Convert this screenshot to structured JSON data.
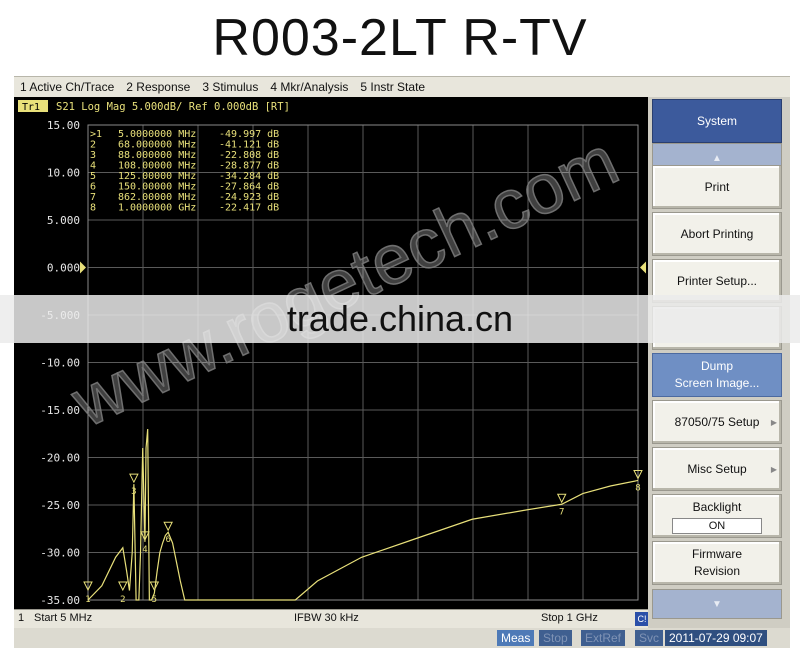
{
  "page_title": "R003-2LT  R-TV",
  "menu": [
    "1 Active Ch/Trace",
    "2 Response",
    "3 Stimulus",
    "4 Mkr/Analysis",
    "5 Instr State"
  ],
  "trace": {
    "label": "Tr1",
    "header": "S21 Log Mag 5.000dB/ Ref 0.000dB [RT]",
    "y_ticks": [
      "15.00",
      "10.00",
      "5.000",
      "0.000",
      "-5.000",
      "-10.00",
      "-15.00",
      "-20.00",
      "-25.00",
      "-30.00",
      "-35.00"
    ],
    "markers": [
      {
        "id": ">1",
        "freq": "5.0000000 MHz",
        "value": "-49.997 dB"
      },
      {
        "id": "2",
        "freq": "68.000000 MHz",
        "value": "-41.121 dB"
      },
      {
        "id": "3",
        "freq": "88.000000 MHz",
        "value": "-22.808 dB"
      },
      {
        "id": "4",
        "freq": "108.00000 MHz",
        "value": "-28.877 dB"
      },
      {
        "id": "5",
        "freq": "125.00000 MHz",
        "value": "-34.284 dB"
      },
      {
        "id": "6",
        "freq": "150.00000 MHz",
        "value": "-27.864 dB"
      },
      {
        "id": "7",
        "freq": "862.00000 MHz",
        "value": "-24.923 dB"
      },
      {
        "id": "8",
        "freq": "1.0000000 GHz",
        "value": "-22.417 dB"
      }
    ]
  },
  "status": {
    "channel": "1",
    "start": "Start 5 MHz",
    "ifbw": "IFBW 30 kHz",
    "stop": "Stop 1 GHz",
    "c1": "C!"
  },
  "bottom": {
    "meas": "Meas",
    "stop": "Stop",
    "extref": "ExtRef",
    "svc": "Svc",
    "datetime": "2011-07-29 09:07"
  },
  "softkeys": {
    "header": "System",
    "print": "Print",
    "abort": "Abort Printing",
    "printer_setup": "Printer Setup...",
    "dump_line1": "Dump",
    "dump_line2": "Screen Image...",
    "setup_87050": "87050/75 Setup",
    "misc_setup": "Misc Setup",
    "backlight": "Backlight",
    "backlight_value": "ON",
    "firmware_line1": "Firmware",
    "firmware_line2": "Revision"
  },
  "watermark": {
    "band_text": "trade.china.cn",
    "diagonal_text": "www.rogetech.com"
  },
  "colors": {
    "trace": "#e8e07a",
    "screen_bg": "#000000",
    "grid": "#666666",
    "softkey_header": "#3c5a9c"
  },
  "chart_data": {
    "type": "line",
    "xlabel": "",
    "ylabel": "",
    "xlim": [
      5,
      1000
    ],
    "ylim": [
      -35,
      15
    ],
    "x_unit": "MHz",
    "y_unit": "dB",
    "series": [
      {
        "x": [
          5,
          30,
          55,
          68,
          75,
          80,
          85,
          88,
          92,
          97,
          100,
          104,
          108,
          110,
          113,
          116,
          120,
          125,
          130,
          135,
          140,
          145,
          150,
          158,
          165,
          172,
          180,
          190,
          380,
          420,
          500,
          600,
          700,
          800,
          862,
          900,
          950,
          1000
        ],
        "y": [
          -49.997,
          -33.5,
          -30.5,
          -29.5,
          -32,
          -34,
          -30,
          -22.808,
          -35,
          -35,
          -30,
          -19,
          -28.877,
          -19,
          -17,
          -35,
          -35,
          -34.284,
          -32,
          -30,
          -29,
          -28.2,
          -27.864,
          -29,
          -31,
          -33,
          -35,
          -36,
          -35,
          -33,
          -30.5,
          -28.5,
          -26.5,
          -25.5,
          -24.923,
          -23.8,
          -23,
          -22.417
        ]
      }
    ]
  }
}
